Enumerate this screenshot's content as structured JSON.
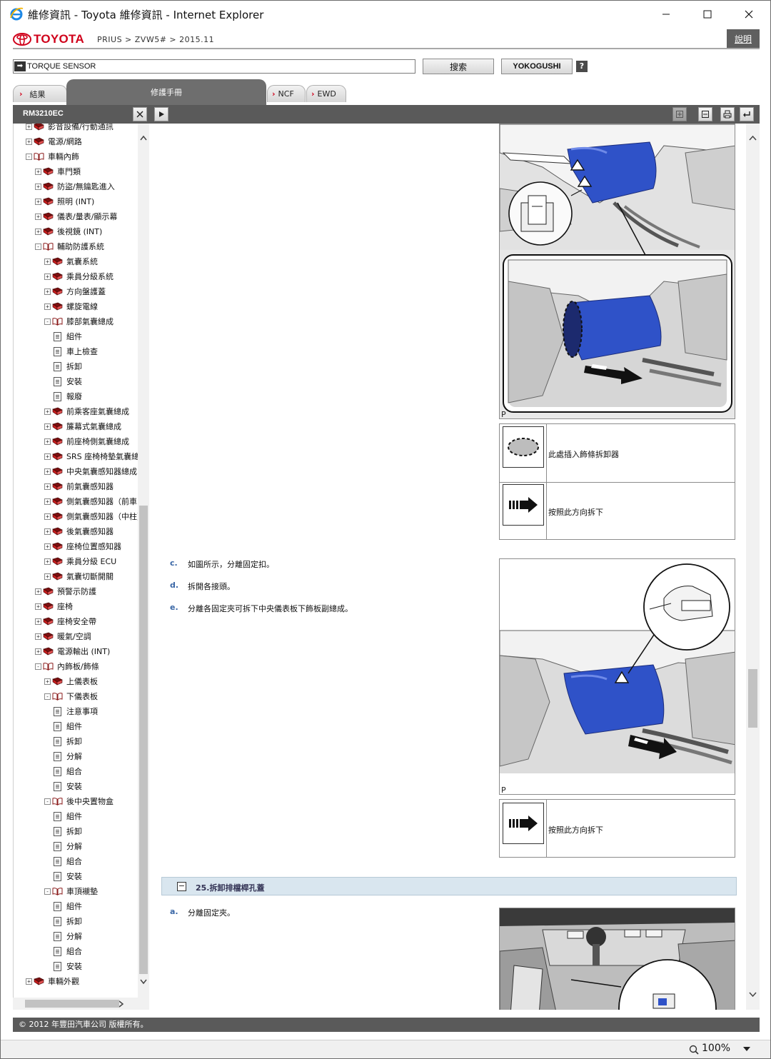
{
  "window": {
    "title": "維修資訊 - Toyota 維修資訊 - Internet Explorer"
  },
  "header": {
    "brand": "TOYOTA",
    "breadcrumb": "PRIUS > ZVW5# > 2015.11",
    "help_label": "說明"
  },
  "search": {
    "value": "TORQUE SENSOR",
    "search_button": "搜索",
    "yokogushi_button": "YOKOGUSHI",
    "help_mark": "?"
  },
  "tabs": {
    "results": "結果",
    "manual": "修護手冊",
    "ncf": "NCF",
    "ewd": "EWD"
  },
  "toolbar": {
    "doc_id": "RM3210EC"
  },
  "tree": {
    "items": [
      {
        "label": "影音設備/行動通訊",
        "level": 0,
        "kind": "book",
        "state": "+"
      },
      {
        "label": "電源/網路",
        "level": 0,
        "kind": "book",
        "state": "+"
      },
      {
        "label": "車輛內飾",
        "level": 0,
        "kind": "open",
        "state": "-"
      },
      {
        "label": "車門類",
        "level": 1,
        "kind": "book",
        "state": "+"
      },
      {
        "label": "防盜/無鑰匙進入",
        "level": 1,
        "kind": "book",
        "state": "+"
      },
      {
        "label": "照明 (INT)",
        "level": 1,
        "kind": "book",
        "state": "+"
      },
      {
        "label": "儀表/量表/顯示幕",
        "level": 1,
        "kind": "book",
        "state": "+"
      },
      {
        "label": "後視鏡 (INT)",
        "level": 1,
        "kind": "book",
        "state": "+"
      },
      {
        "label": "輔助防護系統",
        "level": 1,
        "kind": "open",
        "state": "-"
      },
      {
        "label": "氣囊系統",
        "level": 2,
        "kind": "book",
        "state": "+"
      },
      {
        "label": "乘員分級系統",
        "level": 2,
        "kind": "book",
        "state": "+"
      },
      {
        "label": "方向盤護蓋",
        "level": 2,
        "kind": "book",
        "state": "+"
      },
      {
        "label": "螺旋電線",
        "level": 2,
        "kind": "book",
        "state": "+"
      },
      {
        "label": "膝部氣囊總成",
        "level": 2,
        "kind": "open",
        "state": "-"
      },
      {
        "label": "組件",
        "level": 3,
        "kind": "doc"
      },
      {
        "label": "車上檢查",
        "level": 3,
        "kind": "doc"
      },
      {
        "label": "拆卸",
        "level": 3,
        "kind": "doc"
      },
      {
        "label": "安裝",
        "level": 3,
        "kind": "doc"
      },
      {
        "label": "報廢",
        "level": 3,
        "kind": "doc"
      },
      {
        "label": "前乘客座氣囊總成",
        "level": 2,
        "kind": "book",
        "state": "+"
      },
      {
        "label": "簾幕式氣囊總成",
        "level": 2,
        "kind": "book",
        "state": "+"
      },
      {
        "label": "前座椅側氣囊總成",
        "level": 2,
        "kind": "book",
        "state": "+"
      },
      {
        "label": "SRS 座椅椅墊氣囊總成",
        "level": 2,
        "kind": "book",
        "state": "+"
      },
      {
        "label": "中央氣囊感知器總成",
        "level": 2,
        "kind": "book",
        "state": "+"
      },
      {
        "label": "前氣囊感知器",
        "level": 2,
        "kind": "book",
        "state": "+"
      },
      {
        "label": "側氣囊感知器（前車門）",
        "level": 2,
        "kind": "book",
        "state": "+"
      },
      {
        "label": "側氣囊感知器（中柱）",
        "level": 2,
        "kind": "book",
        "state": "+"
      },
      {
        "label": "後氣囊感知器",
        "level": 2,
        "kind": "book",
        "state": "+"
      },
      {
        "label": "座椅位置感知器",
        "level": 2,
        "kind": "book",
        "state": "+"
      },
      {
        "label": "乘員分級 ECU",
        "level": 2,
        "kind": "book",
        "state": "+"
      },
      {
        "label": "氣囊切斷開關",
        "level": 2,
        "kind": "book",
        "state": "+"
      },
      {
        "label": "預警示防護",
        "level": 1,
        "kind": "book",
        "state": "+"
      },
      {
        "label": "座椅",
        "level": 1,
        "kind": "book",
        "state": "+"
      },
      {
        "label": "座椅安全帶",
        "level": 1,
        "kind": "book",
        "state": "+"
      },
      {
        "label": "暖氣/空調",
        "level": 1,
        "kind": "book",
        "state": "+"
      },
      {
        "label": "電源輸出 (INT)",
        "level": 1,
        "kind": "book",
        "state": "+"
      },
      {
        "label": "內飾板/飾條",
        "level": 1,
        "kind": "open",
        "state": "-"
      },
      {
        "label": "上儀表板",
        "level": 2,
        "kind": "book",
        "state": "+"
      },
      {
        "label": "下儀表板",
        "level": 2,
        "kind": "open",
        "state": "-"
      },
      {
        "label": "注意事項",
        "level": 3,
        "kind": "doc"
      },
      {
        "label": "組件",
        "level": 3,
        "kind": "doc"
      },
      {
        "label": "拆卸",
        "level": 3,
        "kind": "doc"
      },
      {
        "label": "分解",
        "level": 3,
        "kind": "doc"
      },
      {
        "label": "組合",
        "level": 3,
        "kind": "doc"
      },
      {
        "label": "安裝",
        "level": 3,
        "kind": "doc"
      },
      {
        "label": "後中央置物盒",
        "level": 2,
        "kind": "open",
        "state": "-"
      },
      {
        "label": "組件",
        "level": 3,
        "kind": "doc"
      },
      {
        "label": "拆卸",
        "level": 3,
        "kind": "doc"
      },
      {
        "label": "分解",
        "level": 3,
        "kind": "doc"
      },
      {
        "label": "組合",
        "level": 3,
        "kind": "doc"
      },
      {
        "label": "安裝",
        "level": 3,
        "kind": "doc"
      },
      {
        "label": "車頂襯墊",
        "level": 2,
        "kind": "open",
        "state": "-"
      },
      {
        "label": "組件",
        "level": 3,
        "kind": "doc"
      },
      {
        "label": "拆卸",
        "level": 3,
        "kind": "doc"
      },
      {
        "label": "分解",
        "level": 3,
        "kind": "doc"
      },
      {
        "label": "組合",
        "level": 3,
        "kind": "doc"
      },
      {
        "label": "安裝",
        "level": 3,
        "kind": "doc"
      },
      {
        "label": "車輛外觀",
        "level": 0,
        "kind": "book",
        "state": "+"
      }
    ]
  },
  "content": {
    "figure_label_1": "P",
    "figure_label_2": "P",
    "legend_1": {
      "row1": "此處插入飾條拆卸器",
      "row2": "按照此方向拆下"
    },
    "legend_2": {
      "row1": "按照此方向拆下"
    },
    "steps": [
      {
        "letter": "c.",
        "text": "如圖所示，分離固定扣。"
      },
      {
        "letter": "d.",
        "text": "拆開各接頭。"
      },
      {
        "letter": "e.",
        "text": "分離各固定夾可拆下中央儀表板下飾板副總成。"
      }
    ],
    "section_25": {
      "title": "25.拆卸排檔桿孔蓋",
      "toggle": "−"
    },
    "step_25a": {
      "letter": "a.",
      "text": "分離固定夾。"
    }
  },
  "footer": {
    "copyright": "© 2012 年豐田汽車公司 版權所有。"
  },
  "status": {
    "zoom": "100%"
  },
  "colors": {
    "brand_red": "#d0021b",
    "toolbar_gray": "#5a5a5a",
    "part_blue": "#2f52c8"
  }
}
